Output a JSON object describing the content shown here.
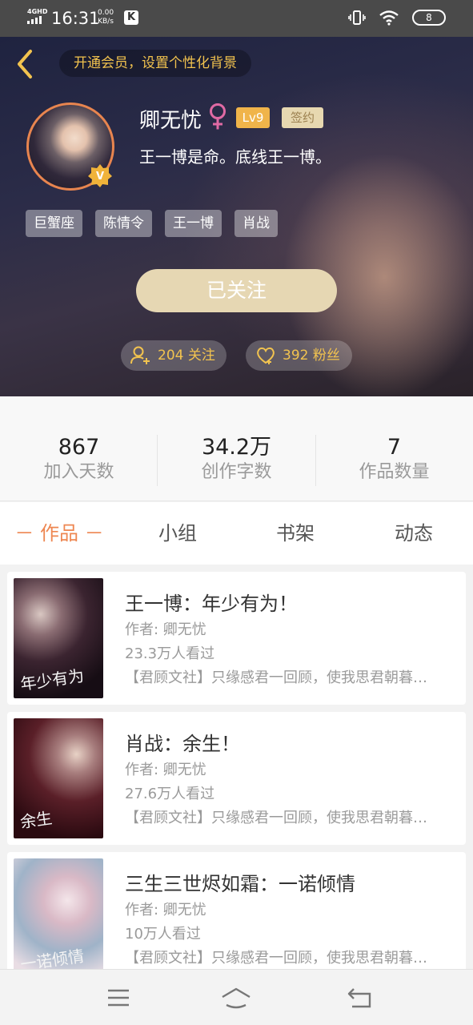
{
  "status_bar": {
    "network": "4GHD",
    "time": "16:31",
    "speed_value": "0.00",
    "speed_unit": "KB/s",
    "app_badge": "K",
    "battery": "8"
  },
  "header": {
    "vip_tip": "开通会员，设置个性化背景",
    "nickname": "卿无忧",
    "level": "Lv9",
    "sign_badge": "签约",
    "bio": "王一博是命。底线王一博。",
    "tags": [
      "巨蟹座",
      "陈情令",
      "王一博",
      "肖战"
    ],
    "follow_button": "已关注",
    "following_text": "204 关注",
    "fans_text": "392 粉丝",
    "accent_color": "#f2c34f"
  },
  "stats": [
    {
      "value": "867",
      "label": "加入天数"
    },
    {
      "value": "34.2万",
      "label": "创作字数"
    },
    {
      "value": "7",
      "label": "作品数量"
    }
  ],
  "tabs": {
    "works": "－ 作品 －",
    "group": "小组",
    "bookshelf": "书架",
    "feed": "动态",
    "active_color": "#ee8752"
  },
  "books": [
    {
      "title": "王一博：年少有为！",
      "author": "作者: 卿无忧",
      "views": "23.3万人看过",
      "desc": "【君顾文社】只缘感君一回顾，使我思君朝暮…",
      "cover_text": "年少有为"
    },
    {
      "title": "肖战：余生！",
      "author": "作者: 卿无忧",
      "views": "27.6万人看过",
      "desc": "【君顾文社】只缘感君一回顾，使我思君朝暮…",
      "cover_text": "余生"
    },
    {
      "title": "三生三世烬如霜：一诺倾情",
      "author": "作者: 卿无忧",
      "views": "10万人看过",
      "desc": "【君顾文社】只缘感君一回顾，使我思君朝暮…",
      "cover_text": "一诺倾情"
    }
  ]
}
